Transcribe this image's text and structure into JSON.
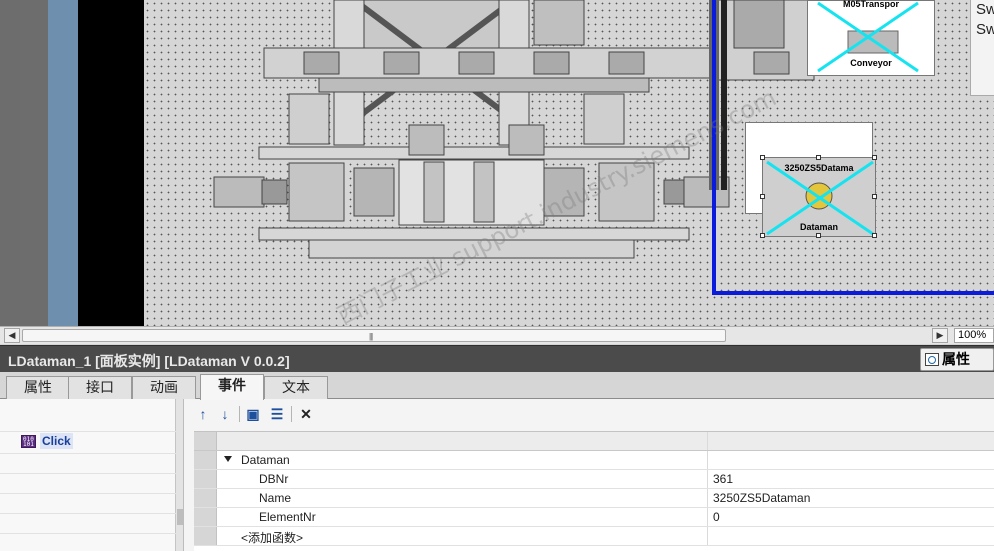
{
  "editor": {
    "right_panel_text": [
      "Sw",
      "Sw"
    ],
    "faceplates": [
      {
        "name": "M05Transpor",
        "label": "Conveyor"
      },
      {
        "name": "3250ZS5Datama",
        "label": "Dataman"
      }
    ],
    "zoom": "100%"
  },
  "inspector": {
    "title": "LDataman_1 [面板实例] [LDataman V 0.0.2]",
    "properties_tab": "属性",
    "tabs": [
      {
        "label": "属性"
      },
      {
        "label": "接口"
      },
      {
        "label": "动画"
      },
      {
        "label": "事件"
      },
      {
        "label": "文本"
      }
    ],
    "active_tab": "事件",
    "events": [
      {
        "label": "Click"
      }
    ],
    "toolbar": {
      "move_up_icon": "arrow-up-icon",
      "move_down_icon": "arrow-down-icon",
      "script_icon": "folder-icon",
      "list_icon": "list-icon",
      "delete_icon": "delete-icon"
    },
    "function_tree": {
      "group": "Dataman",
      "params": [
        {
          "name": "DBNr",
          "value": "361"
        },
        {
          "name": "Name",
          "value": "3250ZS5Dataman"
        },
        {
          "name": "ElementNr",
          "value": "0"
        }
      ],
      "add_function": "<添加函数>"
    }
  },
  "watermark": "西门子工业 support.industry.siemens.com"
}
